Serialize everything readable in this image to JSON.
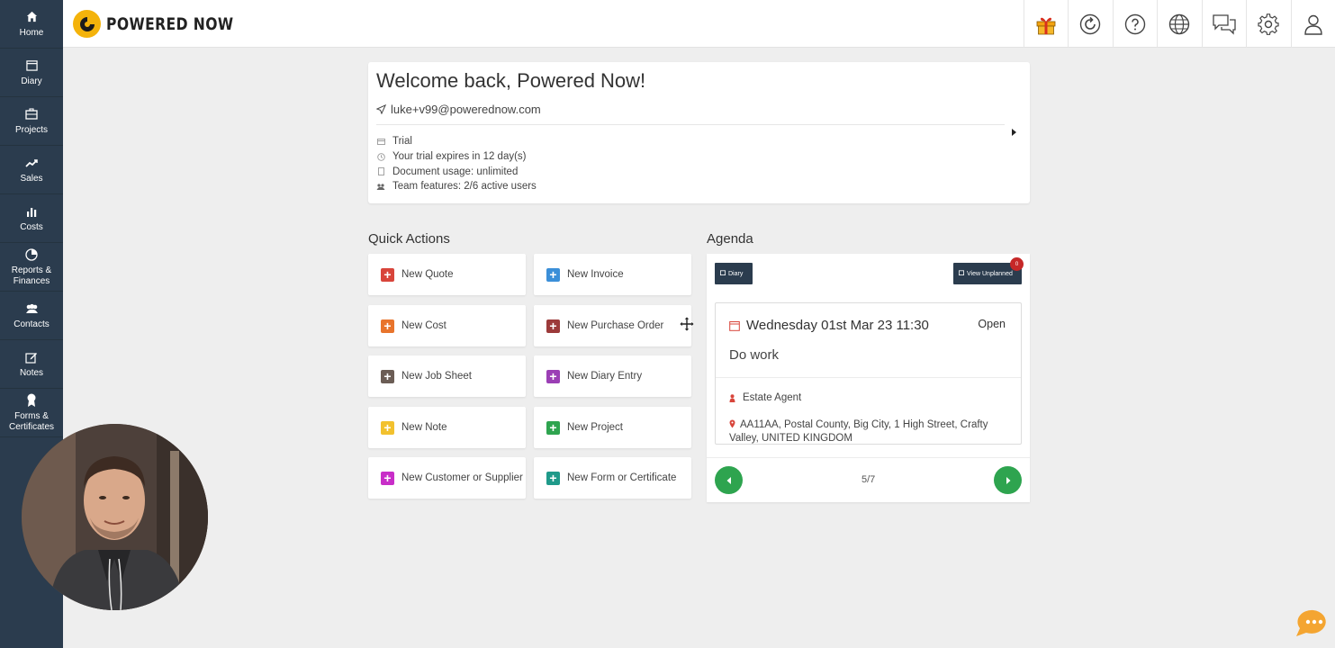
{
  "sidebar": {
    "items": [
      {
        "label": "Home",
        "icon": "home-icon"
      },
      {
        "label": "Diary",
        "icon": "calendar-icon"
      },
      {
        "label": "Projects",
        "icon": "briefcase-icon"
      },
      {
        "label": "Sales",
        "icon": "trending-up-icon"
      },
      {
        "label": "Costs",
        "icon": "bar-chart-icon"
      },
      {
        "label": "Reports & Finances",
        "icon": "pie-chart-icon"
      },
      {
        "label": "Contacts",
        "icon": "users-icon"
      },
      {
        "label": "Notes",
        "icon": "edit-icon"
      },
      {
        "label": "Forms & Certificates",
        "icon": "certificate-icon"
      }
    ]
  },
  "header": {
    "brand": "POWERED NOW",
    "icons": [
      "gift-icon",
      "refresh-icon",
      "help-icon",
      "globe-icon",
      "chat-icon",
      "settings-icon",
      "user-icon"
    ]
  },
  "welcome": {
    "title": "Welcome back, Powered Now!",
    "email": "luke+v99@powerednow.com",
    "lines": [
      {
        "text": "Trial",
        "icon": "card-icon"
      },
      {
        "text": "Your trial expires in 12 day(s)",
        "icon": "clock-icon"
      },
      {
        "text": "Document usage: unlimited",
        "icon": "document-icon"
      },
      {
        "text": "Team features: 2/6 active users",
        "icon": "team-icon"
      }
    ]
  },
  "quick_actions": {
    "title": "Quick Actions",
    "items": [
      {
        "label": "New Quote",
        "color": "#d8453b"
      },
      {
        "label": "New Invoice",
        "color": "#3b8fd8"
      },
      {
        "label": "New Cost",
        "color": "#e8742c"
      },
      {
        "label": "New Purchase Order",
        "color": "#9c3a3a"
      },
      {
        "label": "New Job Sheet",
        "color": "#6b5d55"
      },
      {
        "label": "New Diary Entry",
        "color": "#9b3fb5"
      },
      {
        "label": "New Note",
        "color": "#f2c12e"
      },
      {
        "label": "New Project",
        "color": "#2ea44f"
      },
      {
        "label": "New Customer or Supplier",
        "color": "#c82ec8"
      },
      {
        "label": "New Form or Certificate",
        "color": "#1f9a8a"
      }
    ]
  },
  "agenda": {
    "title": "Agenda",
    "diary_button": "Diary",
    "unplanned_button": "View Unplanned",
    "unplanned_count": "0",
    "event": {
      "date": "Wednesday 01st Mar 23 11:30",
      "status": "Open",
      "title": "Do work",
      "contact": "Estate Agent",
      "address": "AA11AA, Postal County, Big City, 1 High Street, Crafty Valley, UNITED KINGDOM"
    },
    "pagination": "5/7"
  },
  "colors": {
    "sidebar": "#2b3c4e",
    "brand_yellow": "#f4b30b",
    "nav_green": "#2ea44f"
  }
}
